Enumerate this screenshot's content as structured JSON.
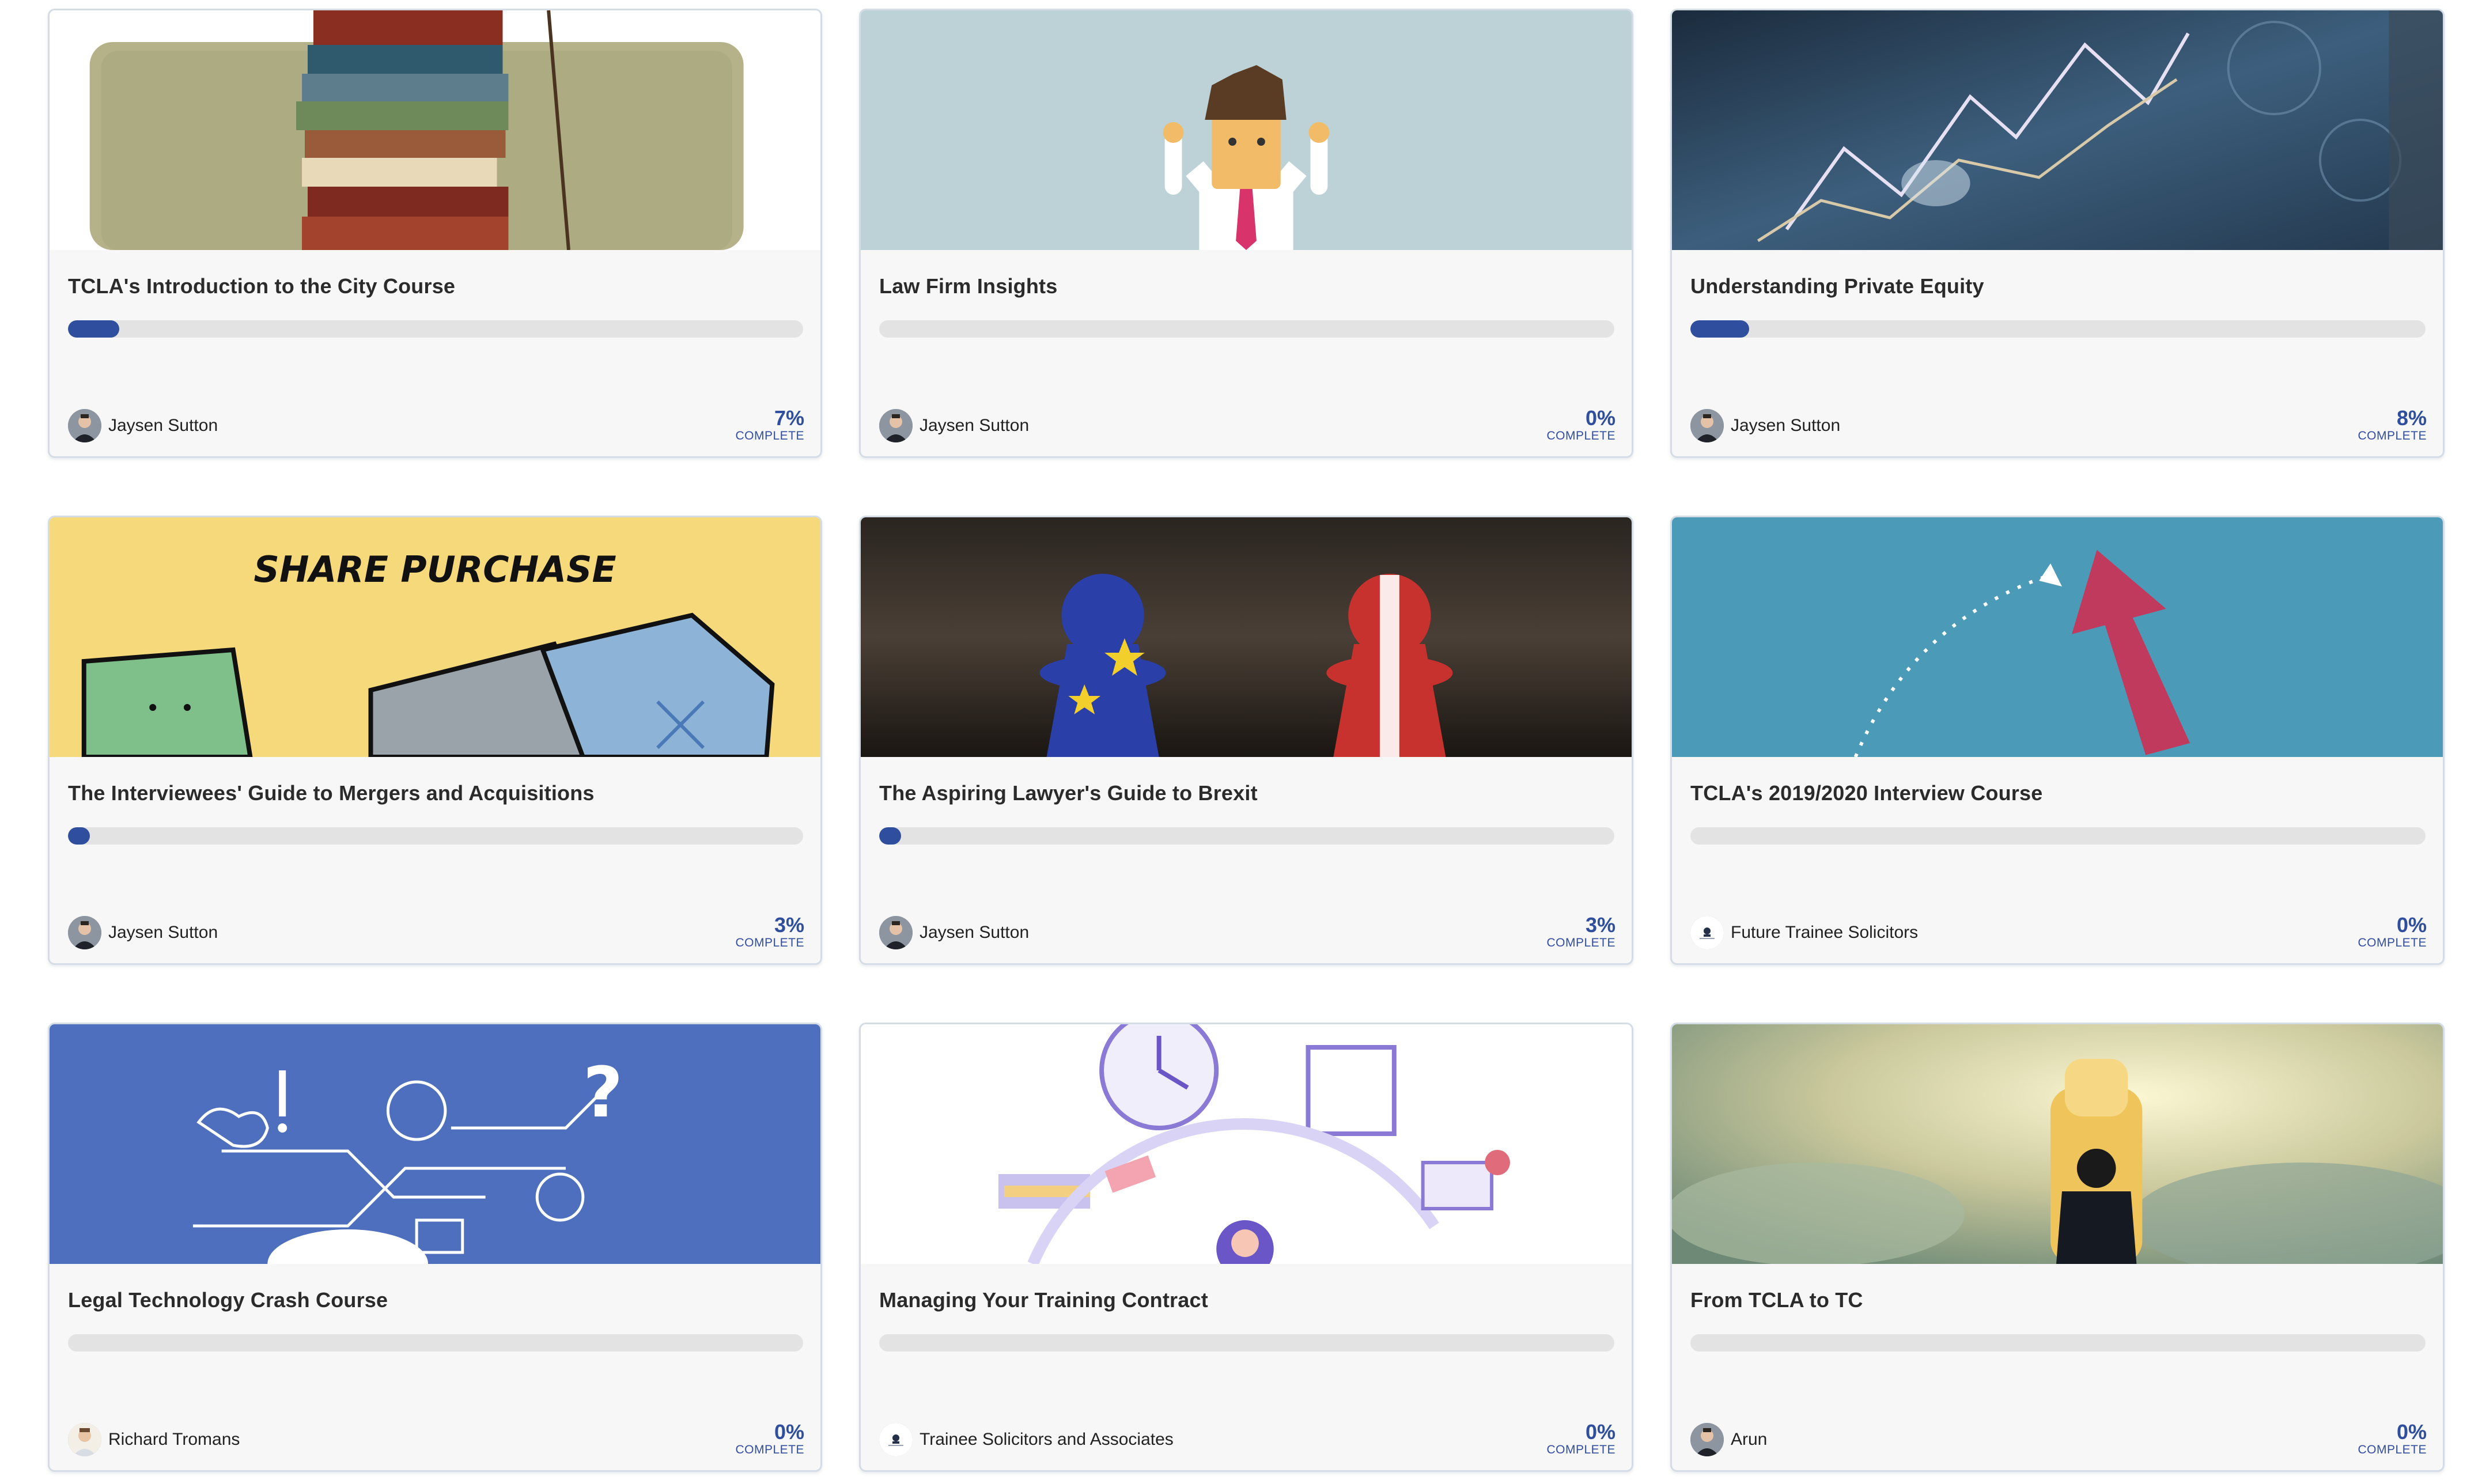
{
  "courses": [
    {
      "title": "TCLA's Introduction to the City Course",
      "author": "Jaysen Sutton",
      "percent": "7%",
      "progress": 0.07,
      "complete_label": "COMPLETE",
      "thumb": "books",
      "avatar": "person-dark"
    },
    {
      "title": "Law Firm Insights",
      "author": "Jaysen Sutton",
      "percent": "0%",
      "progress": 0,
      "complete_label": "COMPLETE",
      "thumb": "businessman",
      "avatar": "person-dark"
    },
    {
      "title": "Understanding Private Equity",
      "author": "Jaysen Sutton",
      "percent": "8%",
      "progress": 0.08,
      "complete_label": "COMPLETE",
      "thumb": "finance",
      "avatar": "person-dark"
    },
    {
      "title": "The Interviewees' Guide to Mergers and Acquisitions",
      "author": "Jaysen Sutton",
      "percent": "3%",
      "progress": 0.03,
      "complete_label": "COMPLETE",
      "thumb": "share-purchase",
      "thumb_text": "SHARE PURCHASE",
      "avatar": "person-dark"
    },
    {
      "title": "The Aspiring Lawyer's Guide to Brexit",
      "author": "Jaysen Sutton",
      "percent": "3%",
      "progress": 0.03,
      "complete_label": "COMPLETE",
      "thumb": "brexit",
      "avatar": "person-dark"
    },
    {
      "title": "TCLA's 2019/2020 Interview Course",
      "author": "Future Trainee Solicitors",
      "percent": "0%",
      "progress": 0,
      "complete_label": "COMPLETE",
      "thumb": "arrow",
      "avatar": "logo"
    },
    {
      "title": "Legal Technology Crash Course",
      "author": "Richard Tromans",
      "percent": "0%",
      "progress": 0,
      "complete_label": "COMPLETE",
      "thumb": "legaltech",
      "avatar": "person-light"
    },
    {
      "title": "Managing Your Training Contract",
      "author": "Trainee Solicitors and Associates",
      "percent": "0%",
      "progress": 0,
      "complete_label": "COMPLETE",
      "thumb": "managing",
      "avatar": "logo"
    },
    {
      "title": "From TCLA to TC",
      "author": "Arun",
      "percent": "0%",
      "progress": 0,
      "complete_label": "COMPLETE",
      "thumb": "clouds",
      "avatar": "person-dark"
    }
  ],
  "colors": {
    "accent": "#2f4f9e",
    "track": "#e3e3e3",
    "card_bg": "#f7f7f7",
    "card_border": "#d4dde6"
  }
}
